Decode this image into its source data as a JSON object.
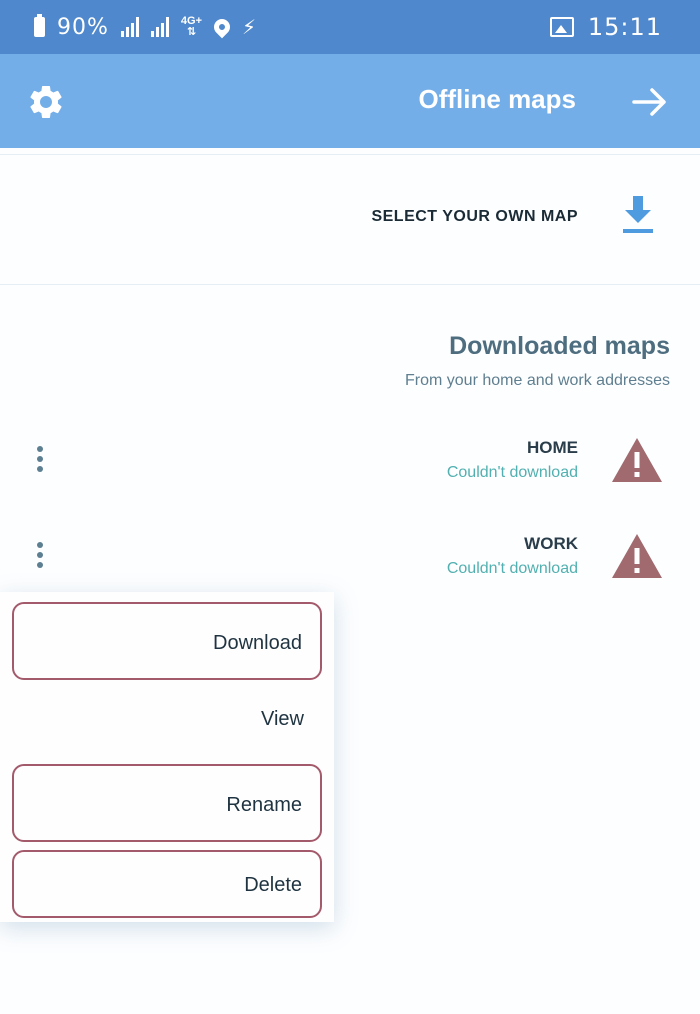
{
  "status_bar": {
    "battery_text": "90%",
    "sig1_tag": "4G+",
    "sig2_tag": "",
    "net_type": "4G+",
    "time": "15:11"
  },
  "app_bar": {
    "title": "Offline maps",
    "background_color": "#74aee8"
  },
  "select_map": {
    "label": "SELECT YOUR OWN MAP"
  },
  "downloaded": {
    "title": "Downloaded maps",
    "subtitle": "From your home and work addresses",
    "items": [
      {
        "name": "HOME",
        "status": "Couldn't download"
      },
      {
        "name": "WORK",
        "status": "Couldn't download"
      }
    ]
  },
  "menu": {
    "items": [
      {
        "label": "Download"
      },
      {
        "label": "View"
      },
      {
        "label": "Rename"
      },
      {
        "label": "Delete"
      }
    ]
  },
  "colors": {
    "status_bar": "#4f88cc",
    "warning": "#a06a6f",
    "accent": "#4f9be0",
    "highlight_border": "#a35a6b"
  }
}
